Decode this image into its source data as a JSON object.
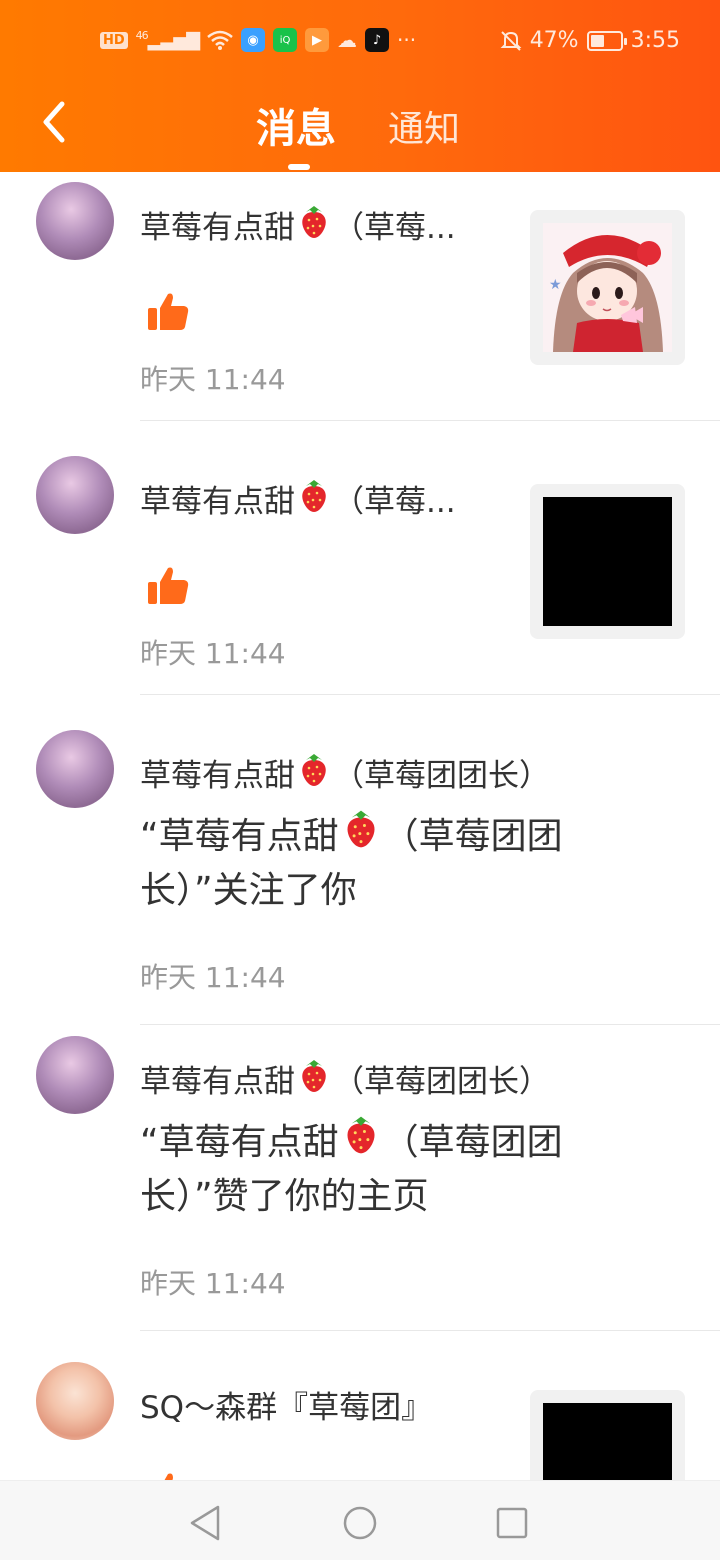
{
  "status_bar": {
    "hd": "HD",
    "net": "46",
    "battery_percent": "47%",
    "battery_level": 0.47,
    "time": "3:55",
    "dots": "···"
  },
  "header": {
    "tab_messages": "消息",
    "tab_notifications": "通知"
  },
  "items": [
    {
      "name": "草莓有点甜",
      "name_suffix": "（草莓...",
      "type": "like",
      "time": "昨天 11:44",
      "thumbnail": "anime-girl"
    },
    {
      "name": "草莓有点甜",
      "name_suffix": "（草莓...",
      "type": "like",
      "time": "昨天 11:44",
      "thumbnail": "black"
    },
    {
      "name": "草莓有点甜",
      "name_suffix": "（草莓团团长）",
      "type": "follow",
      "message_pre": "“草莓有点甜",
      "message_post": "（草莓团团长）”关注了你",
      "time": "昨天 11:44"
    },
    {
      "name": "草莓有点甜",
      "name_suffix": "（草莓团团长）",
      "type": "profile_like",
      "message_pre": "“草莓有点甜",
      "message_post": "（草莓团团长）”赞了你的主页",
      "time": "昨天 11:44"
    },
    {
      "name": "SQ～森群『草莓团』",
      "name_suffix": "",
      "type": "like",
      "thumbnail": "black"
    }
  ],
  "colors": {
    "header_start": "#ff7a00",
    "header_end": "#ff5410",
    "like_icon": "#ff6a1a",
    "time_text": "#999999"
  }
}
